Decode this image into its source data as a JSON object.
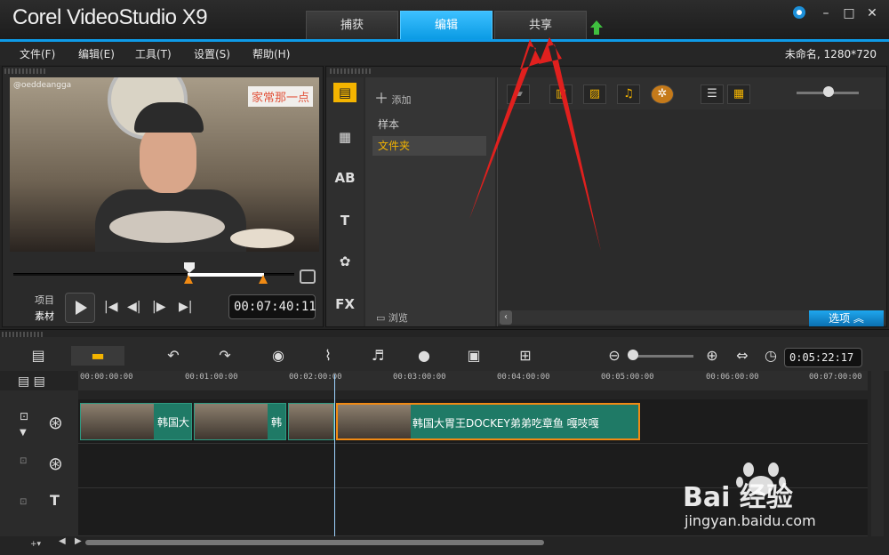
{
  "titlebar": {
    "brand": "Corel VideoStudio X9",
    "tabs": [
      {
        "label": "捕获",
        "active": false
      },
      {
        "label": "编辑",
        "active": true
      },
      {
        "label": "共享",
        "active": false
      }
    ],
    "window_buttons": [
      "help-icon",
      "minimize-icon",
      "maximize-icon",
      "close-icon"
    ]
  },
  "menubar": {
    "items": [
      "文件(F)",
      "编辑(E)",
      "工具(T)",
      "设置(S)",
      "帮助(H)"
    ],
    "project_info": "未命名, 1280*720"
  },
  "preview": {
    "watermark": "@oeddeangga",
    "caption": "家常那一点",
    "mode_labels": {
      "project": "项目",
      "clip": "素材"
    },
    "timecode": "00:07:40:11"
  },
  "library": {
    "add_label": "添加",
    "folders": [
      {
        "label": "样本",
        "selected": false
      },
      {
        "label": "文件夹",
        "selected": true
      }
    ],
    "browse_label": "浏览",
    "options_label": "选项",
    "side_icons": [
      "media-icon",
      "instant-project-icon",
      "transition-icon",
      "title-icon",
      "graphic-icon",
      "filter-icon"
    ]
  },
  "timeline": {
    "timecode": "0:05:22:17",
    "ruler_ticks": [
      "00:00:00:00",
      "00:01:00:00",
      "00:02:00:00",
      "00:03:00:00",
      "00:04:00:00",
      "00:05:00:00",
      "00:06:00:00",
      "00:07:00:00"
    ],
    "clips": [
      {
        "title": "韩国大"
      },
      {
        "title": "韩"
      },
      {
        "title": ""
      },
      {
        "title": "韩国大胃王DOCKEY弟弟吃章鱼 嘎吱嘎"
      }
    ]
  },
  "watermark_site": {
    "logo_text": "Bai 经验",
    "url": "jingyan.baidu.com"
  },
  "colors": {
    "accent": "#0e9be8",
    "clip_green": "#1f7a66",
    "arrow_red": "#e0201e",
    "highlight": "#f4b400"
  }
}
